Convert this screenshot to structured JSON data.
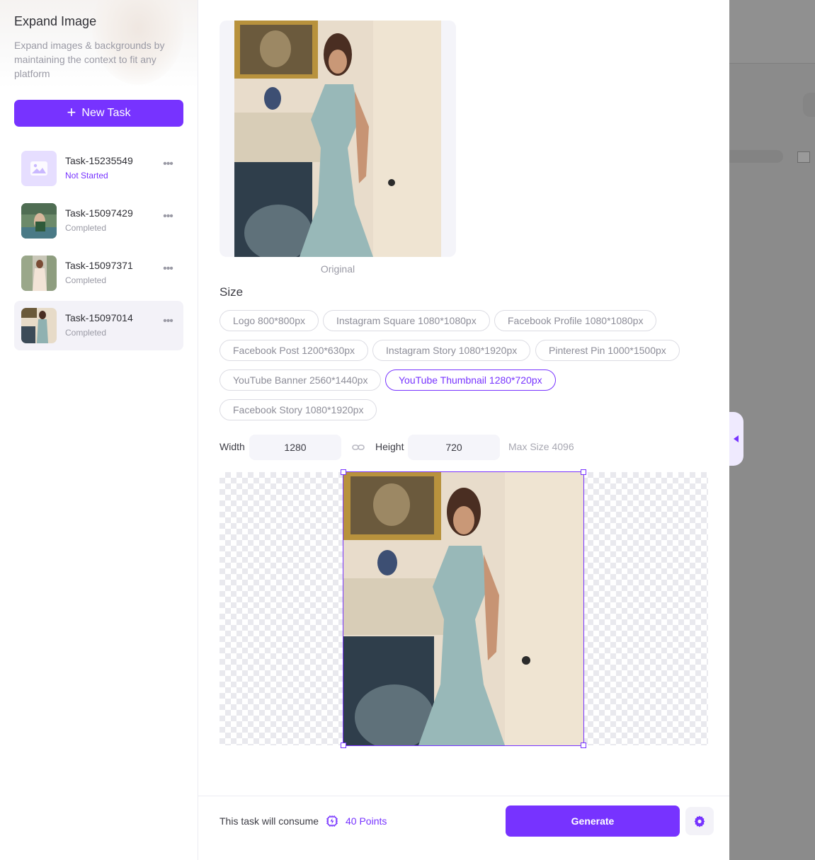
{
  "sidebar": {
    "title": "Expand Image",
    "subtitle": "Expand images & backgrounds by maintaining the context to fit any platform",
    "new_task_label": "New Task",
    "tasks": [
      {
        "name": "Task-15235549",
        "status": "Not Started",
        "active": false
      },
      {
        "name": "Task-15097429",
        "status": "Completed",
        "active": false
      },
      {
        "name": "Task-15097371",
        "status": "Completed",
        "active": false
      },
      {
        "name": "Task-15097014",
        "status": "Completed",
        "active": true
      }
    ]
  },
  "main": {
    "original_label": "Original",
    "size_title": "Size",
    "presets": [
      "Logo 800*800px",
      "Instagram Square 1080*1080px",
      "Facebook Profile 1080*1080px",
      "Facebook Post 1200*630px",
      "Instagram Story 1080*1920px",
      "Pinterest Pin 1000*1500px",
      "YouTube Banner 2560*1440px",
      "YouTube Thumbnail 1280*720px",
      "Facebook Story 1080*1920px"
    ],
    "selected_preset": "YouTube Thumbnail 1280*720px",
    "width_label": "Width",
    "width_value": "1280",
    "height_label": "Height",
    "height_value": "720",
    "max_size": "Max Size 4096"
  },
  "footer": {
    "consume_text": "This task will consume",
    "points": "40 Points",
    "generate_label": "Generate"
  },
  "colors": {
    "accent": "#7733ff",
    "muted_text": "#9a9aa5",
    "overlay": "#8a8a8a"
  }
}
